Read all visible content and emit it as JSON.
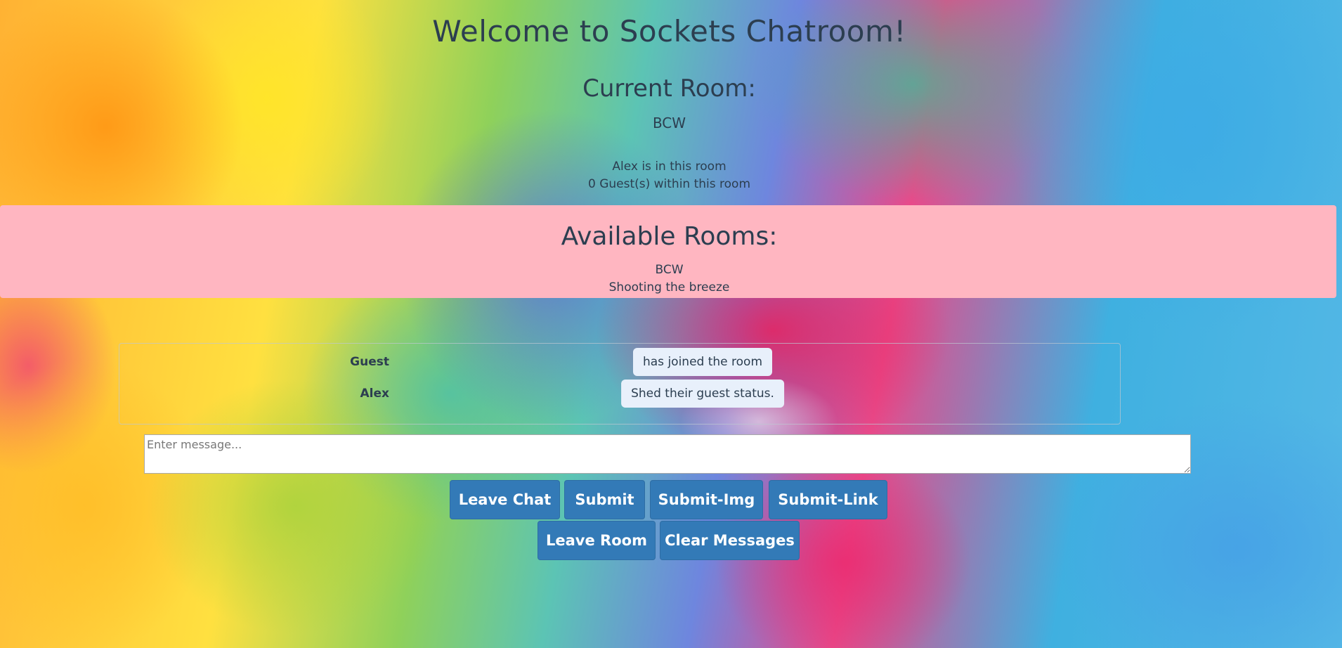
{
  "page": {
    "title": "Welcome to Sockets Chatroom!"
  },
  "current_room": {
    "heading": "Current Room:",
    "name": "BCW",
    "occupants_text": "Alex is in this room",
    "guests_text": "0 Guest(s) within this room"
  },
  "available_rooms": {
    "heading": "Available Rooms:",
    "rooms": [
      "BCW",
      "Shooting the breeze"
    ],
    "panel_color": "#ffb6c1"
  },
  "messages": [
    {
      "user": "Guest",
      "text": "has joined the room"
    },
    {
      "user": "Alex",
      "text": "Shed their guest status."
    }
  ],
  "composer": {
    "placeholder": "Enter message..."
  },
  "buttons": {
    "leave_chat": "Leave Chat",
    "submit": "Submit",
    "submit_img": "Submit-Img",
    "submit_link": "Submit-Link",
    "leave_room": "Leave Room",
    "clear_messages": "Clear Messages",
    "color": "#337ab7"
  }
}
